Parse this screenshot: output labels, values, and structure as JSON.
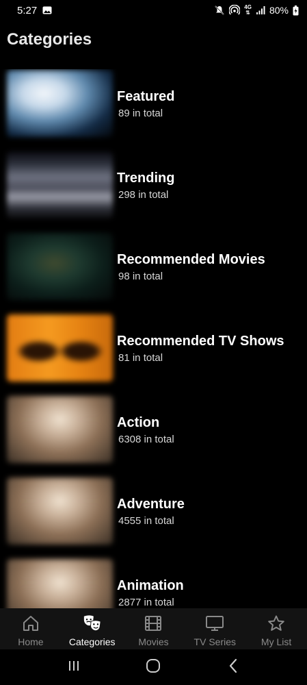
{
  "status_bar": {
    "time": "5:27",
    "battery": "80%",
    "network": "4G",
    "icons": [
      "image-icon",
      "mute-icon",
      "hotspot-icon",
      "network-4g-icon",
      "signal-icon",
      "battery-icon"
    ]
  },
  "page": {
    "title": "Categories"
  },
  "categories": [
    {
      "name": "Featured",
      "count": "89 in total",
      "thumb": "featured-thumbnail"
    },
    {
      "name": "Trending",
      "count": "298 in total",
      "thumb": "trending-thumbnail"
    },
    {
      "name": "Recommended Movies",
      "count": "98 in total",
      "thumb": "recommended-movies-thumbnail"
    },
    {
      "name": "Recommended TV Shows",
      "count": "81 in total",
      "thumb": "recommended-tv-shows-thumbnail"
    },
    {
      "name": "Action",
      "count": "6308 in total",
      "thumb": "action-thumbnail"
    },
    {
      "name": "Adventure",
      "count": "4555 in total",
      "thumb": "adventure-thumbnail"
    },
    {
      "name": "Animation",
      "count": "2877 in total",
      "thumb": "animation-thumbnail"
    }
  ],
  "bottom_nav": {
    "items": [
      {
        "label": "Home",
        "icon": "home-icon",
        "active": false
      },
      {
        "label": "Categories",
        "icon": "theater-masks-icon",
        "active": true
      },
      {
        "label": "Movies",
        "icon": "film-icon",
        "active": false
      },
      {
        "label": "TV Series",
        "icon": "tv-icon",
        "active": false
      },
      {
        "label": "My List",
        "icon": "star-icon",
        "active": false
      }
    ]
  },
  "colors": {
    "background": "#000000",
    "nav_background": "#131313",
    "active": "#ffffff",
    "inactive": "#8a8a8a"
  }
}
